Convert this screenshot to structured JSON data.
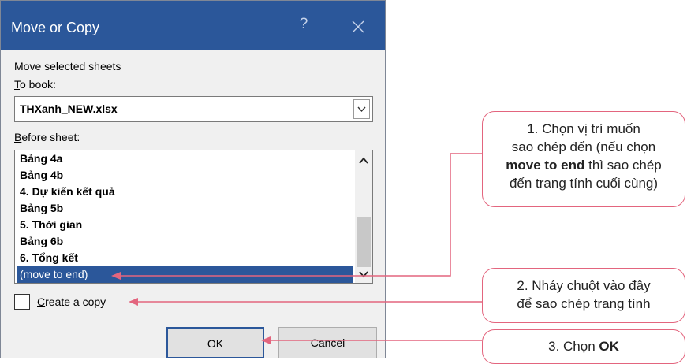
{
  "dialog": {
    "title": "Move or Copy",
    "help_glyph": "?",
    "section_label": "Move selected sheets",
    "to_book_label": "To book:",
    "to_book_accel": "T",
    "to_book_rest": "o book:",
    "to_book_value": "THXanh_NEW.xlsx",
    "before_sheet_accel": "B",
    "before_sheet_rest": "efore sheet:",
    "sheets": [
      "Bảng 4a",
      "Bảng 4b",
      "4. Dự kiến kết quả",
      "Bảng 5b",
      "5. Thời gian",
      "Bảng 6b",
      "6. Tổng kết",
      "(move to end)"
    ],
    "selected_sheet_index": 7,
    "create_copy_accel": "C",
    "create_copy_rest": "reate a copy",
    "create_copy_checked": false,
    "ok_label": "OK",
    "cancel_label": "Cancel"
  },
  "callouts": {
    "c1_line1": "1. Chọn vị trí muốn",
    "c1_line2": "sao chép đến (nếu chọn",
    "c1_bold": "move to end",
    "c1_line3_rest": " thì sao chép",
    "c1_line4": "đến trang tính cuối cùng)",
    "c2_line1": "2. Nháy chuột vào đây",
    "c2_line2": "để sao chép trang tính",
    "c3_prefix": "3. Chọn ",
    "c3_bold": "OK"
  },
  "colors": {
    "titlebar": "#2b579a",
    "selection": "#2b579a",
    "callout_border": "#e3657e"
  }
}
